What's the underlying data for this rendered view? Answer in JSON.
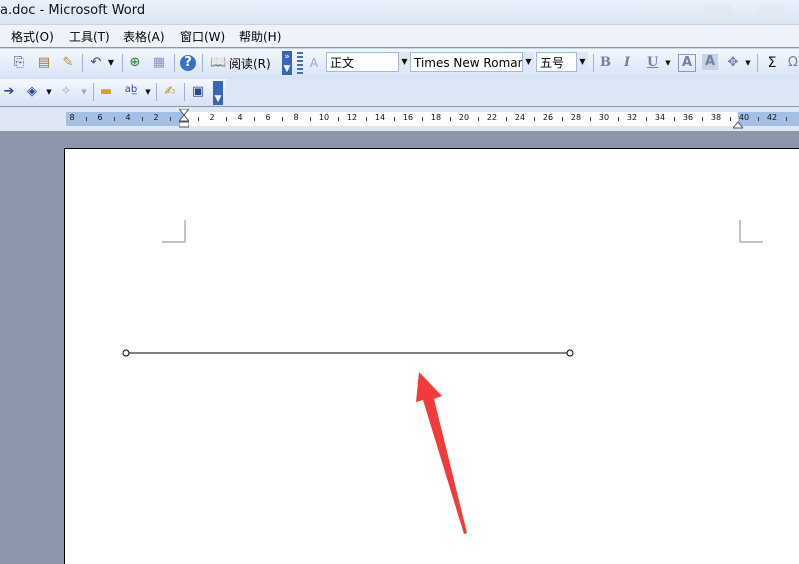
{
  "window": {
    "title": "a.doc - Microsoft Word"
  },
  "menubar": {
    "items": [
      "格式(O)",
      "工具(T)",
      "表格(A)",
      "窗口(W)",
      "帮助(H)"
    ]
  },
  "toolbar": {
    "read_label": "阅读(R)",
    "style_value": "正文",
    "font_value": "Times New Roman",
    "size_value": "五号",
    "bold": "B",
    "italic": "I",
    "underline": "U",
    "sum": "Σ"
  },
  "ruler": {
    "labels_left": [
      "8",
      "6",
      "4",
      "2"
    ],
    "labels_right": [
      "2",
      "4",
      "6",
      "8",
      "10",
      "12",
      "14",
      "16",
      "18",
      "20",
      "22",
      "24",
      "26",
      "28",
      "30",
      "32",
      "34",
      "36",
      "38",
      "40",
      "42"
    ]
  },
  "annotation": {
    "arrow_color": "#ef3b3b"
  },
  "icons": [
    "undo-icon",
    "help-icon",
    "book-icon",
    "folder-icon",
    "spell-check-icon",
    "drawing-icon"
  ]
}
